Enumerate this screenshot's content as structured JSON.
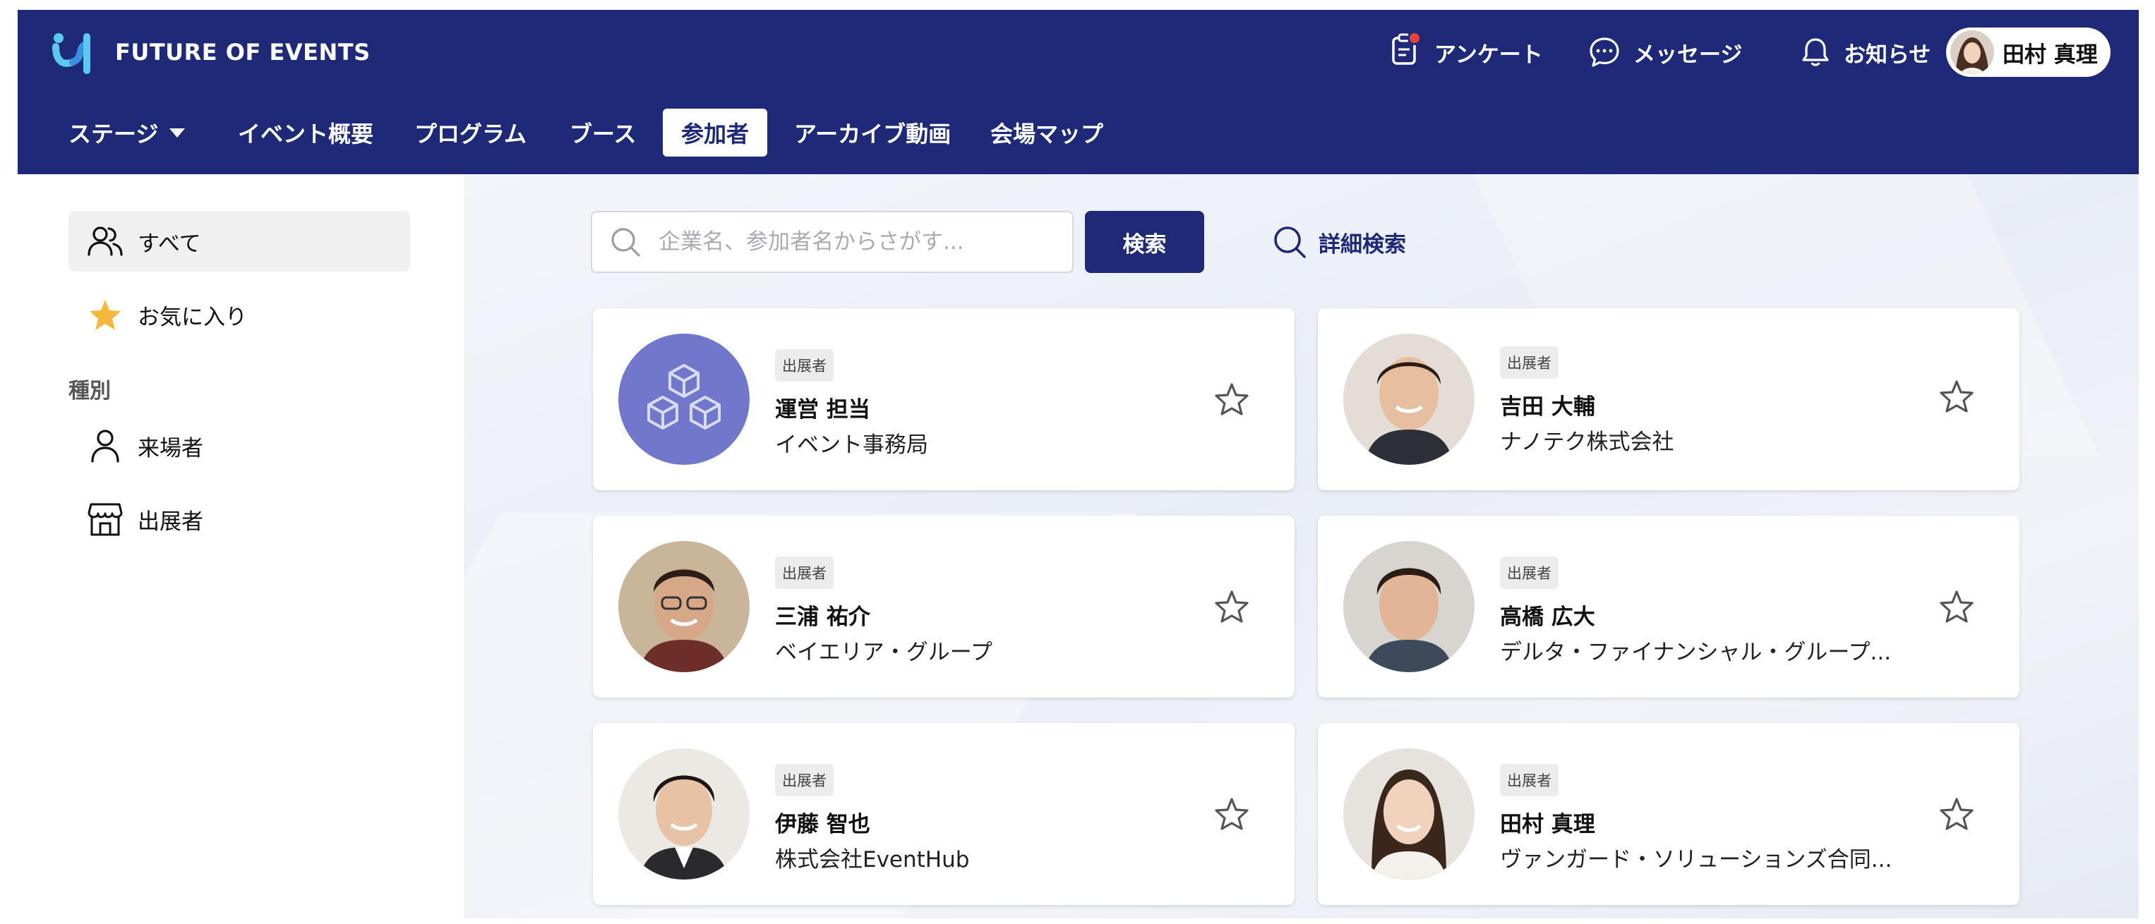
{
  "brand": {
    "name": "FUTURE OF EVENTS"
  },
  "top_menu": {
    "survey": "アンケート",
    "messages": "メッセージ",
    "notifications": "お知らせ",
    "user_name": "田村 真理"
  },
  "nav": {
    "stage": "ステージ",
    "overview": "イベント概要",
    "program": "プログラム",
    "booth": "ブース",
    "participants": "参加者",
    "archive": "アーカイブ動画",
    "venue_map": "会場マップ"
  },
  "sidebar": {
    "all": "すべて",
    "favorites": "お気に入り",
    "type_heading": "種別",
    "visitors": "来場者",
    "exhibitors": "出展者"
  },
  "search": {
    "placeholder": "企業名、参加者名からさがす...",
    "button": "検索",
    "advanced": "詳細検索"
  },
  "participants": [
    {
      "badge": "出展者",
      "name": "運営 担当",
      "company": "イベント事務局",
      "avatar": "cubes-logo-icon"
    },
    {
      "badge": "出展者",
      "name": "吉田 大輔",
      "company": "ナノテク株式会社",
      "avatar": "person-photo"
    },
    {
      "badge": "出展者",
      "name": "三浦 祐介",
      "company": "ベイエリア・グループ",
      "avatar": "person-photo"
    },
    {
      "badge": "出展者",
      "name": "高橋 広大",
      "company": "デルタ・ファイナンシャル・グループ...",
      "avatar": "person-photo"
    },
    {
      "badge": "出展者",
      "name": "伊藤 智也",
      "company": "株式会社EventHub",
      "avatar": "person-photo"
    },
    {
      "badge": "出展者",
      "name": "田村 真理",
      "company": "ヴァンガード・ソリューションズ合同...",
      "avatar": "person-photo"
    }
  ],
  "colors": {
    "primary": "#1e2a78",
    "notify_dot": "#e8413a",
    "favorite_star": "#f5b83d",
    "org_avatar": "#7178cc"
  }
}
